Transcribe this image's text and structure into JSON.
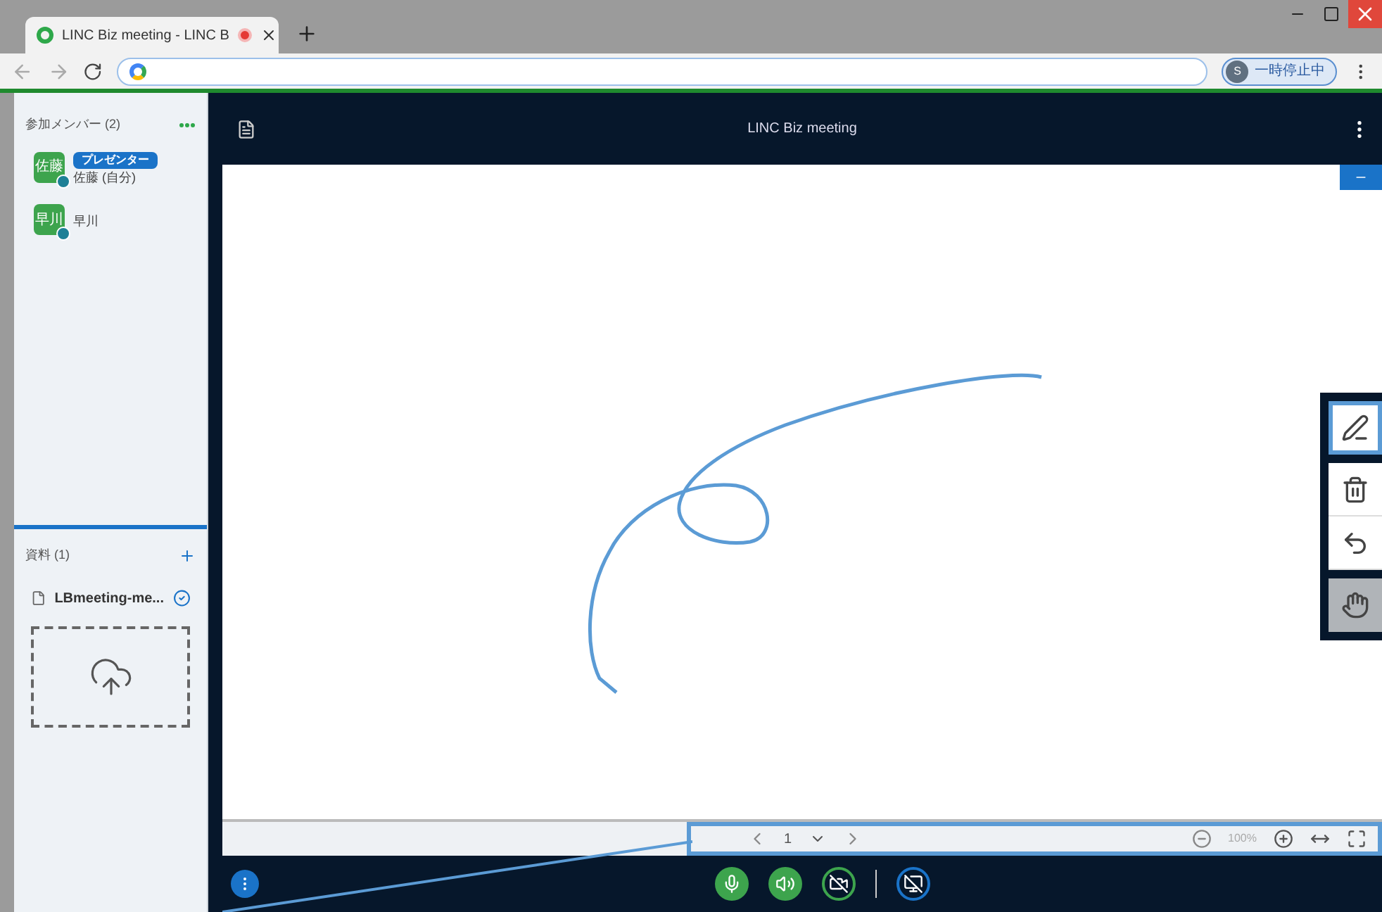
{
  "browser": {
    "tab_title": "LINC Biz meeting - LINC B",
    "profile_initial": "S",
    "profile_status": "一時停止中"
  },
  "members": {
    "title": "参加メンバー",
    "count": "(2)",
    "items": [
      {
        "avatar": "佐藤",
        "badge": "プレゼンター",
        "name": "佐藤 (自分)"
      },
      {
        "avatar": "早川",
        "name": "早川"
      }
    ]
  },
  "files": {
    "title": "資料",
    "count": "(1)",
    "items": [
      {
        "name": "LBmeeting-me...",
        "checked": true
      }
    ]
  },
  "meeting": {
    "title": "LINC Biz meeting"
  },
  "tools": [
    {
      "kind": "pen",
      "selected": true
    },
    {
      "kind": "trash",
      "selected": false
    },
    {
      "kind": "undo",
      "selected": false
    },
    {
      "kind": "hand",
      "selected": false
    }
  ],
  "page_nav": {
    "page": "1",
    "zoom": "100%"
  },
  "controls": [
    {
      "kind": "mic",
      "on": true
    },
    {
      "kind": "speaker",
      "on": true
    },
    {
      "kind": "camera",
      "on": false
    },
    {
      "kind": "screen",
      "on": false
    }
  ]
}
